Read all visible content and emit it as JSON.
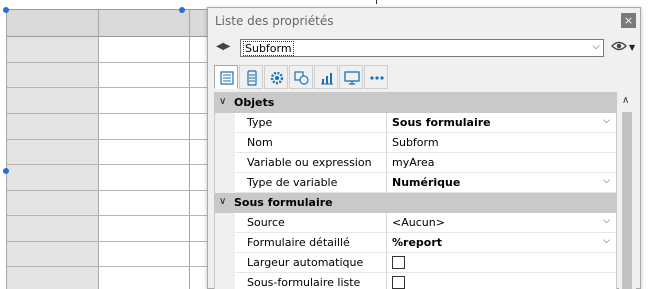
{
  "window": {
    "title": "Liste des propriétés",
    "close_glyph": "×"
  },
  "object_selector": {
    "value": "Subform",
    "nav_glyph": "◀▶",
    "dropdown_glyph": "⌵"
  },
  "toolbar": {
    "tabs": [
      {
        "icon": "list-icon",
        "active": true
      },
      {
        "icon": "database-icon"
      },
      {
        "icon": "gear-icon"
      },
      {
        "icon": "shapes-icon"
      },
      {
        "icon": "chart-icon"
      },
      {
        "icon": "monitor-icon"
      },
      {
        "icon": "more-icon"
      }
    ]
  },
  "sections": [
    {
      "label": "Objets",
      "properties": [
        {
          "name": "Type",
          "value": "Sous formulaire",
          "bold": true,
          "kind": "dropdown"
        },
        {
          "name": "Nom",
          "value": "Subform",
          "bold": false,
          "kind": "text"
        },
        {
          "name": "Variable ou expression",
          "value": "myArea",
          "bold": false,
          "kind": "text"
        },
        {
          "name": "Type de variable",
          "value": "Numérique",
          "bold": true,
          "kind": "dropdown"
        }
      ]
    },
    {
      "label": "Sous formulaire",
      "properties": [
        {
          "name": "Source",
          "value": "<Aucun>",
          "bold": false,
          "kind": "dropdown"
        },
        {
          "name": "Formulaire détaillé",
          "value": "%report",
          "bold": true,
          "kind": "dropdown"
        },
        {
          "name": "Largeur automatique",
          "value": "",
          "kind": "checkbox",
          "checked": false
        },
        {
          "name": "Sous-formulaire liste",
          "value": "",
          "kind": "checkbox",
          "checked": false
        }
      ]
    }
  ],
  "colors": {
    "selection_handle": "#2b6cd6",
    "section_header": "#c9c9c9"
  }
}
